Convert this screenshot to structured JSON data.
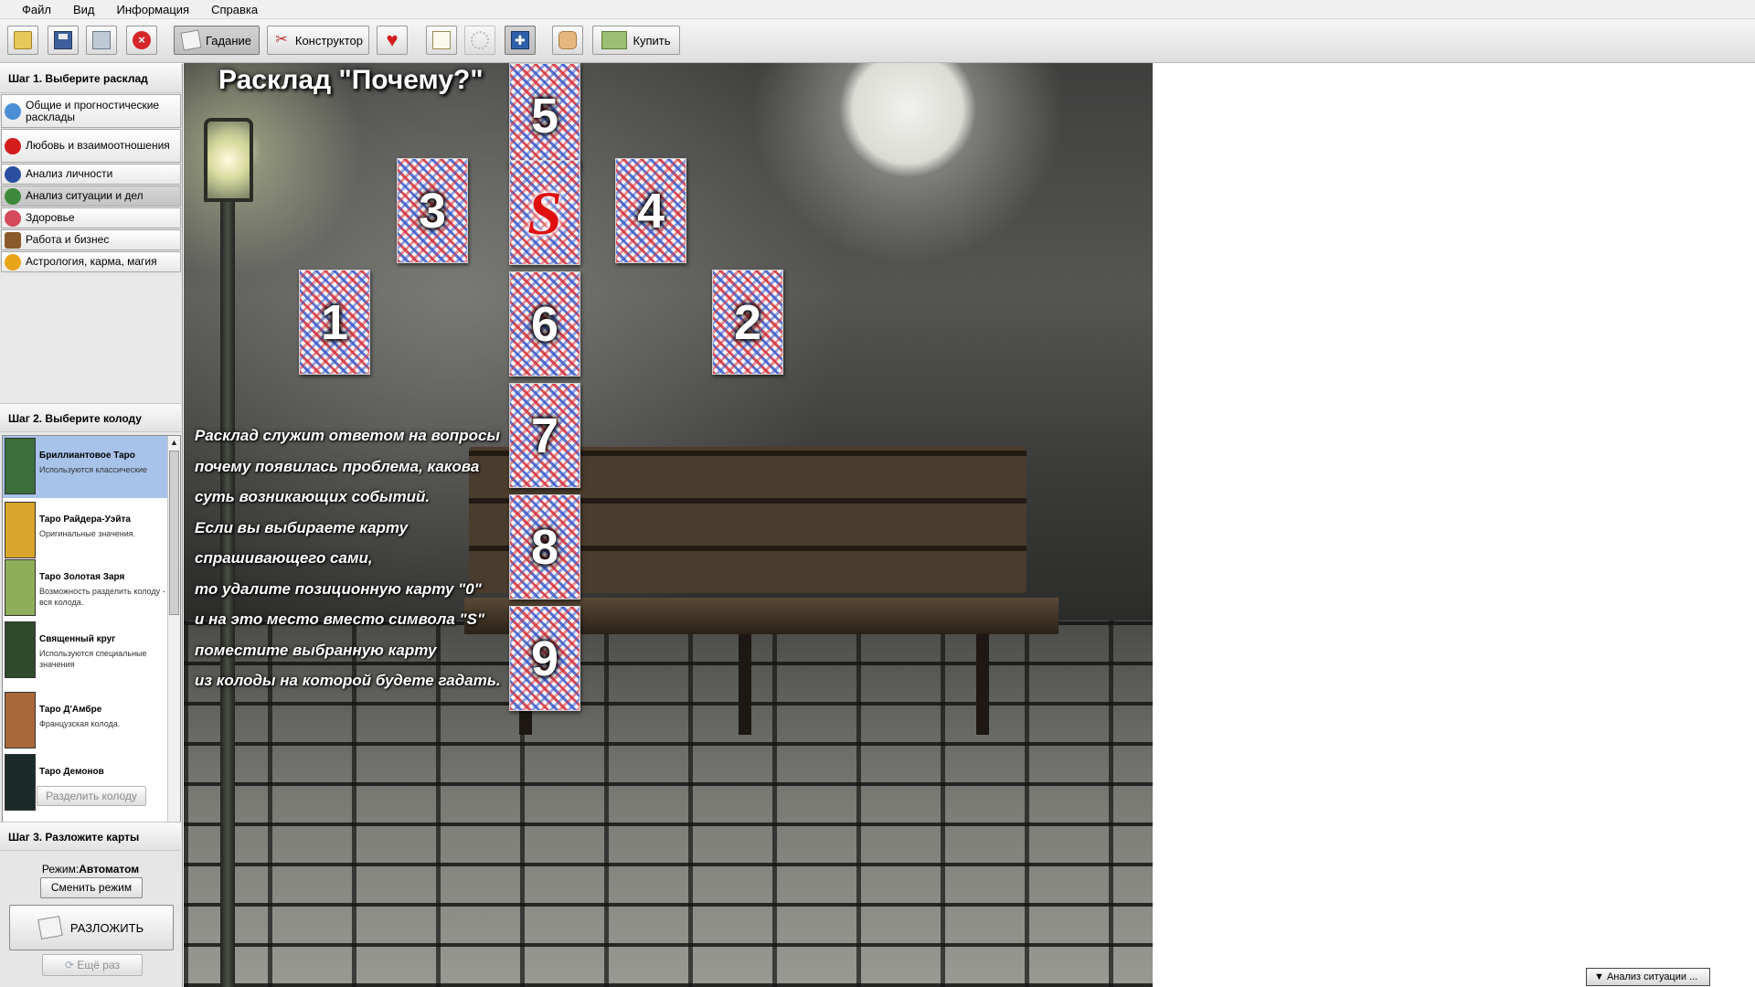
{
  "menu": {
    "items": [
      "Файл",
      "Вид",
      "Информация",
      "Справка"
    ]
  },
  "toolbar": {
    "open_icon": "folder-open-icon",
    "save_icon": "floppy-disk-icon",
    "print_icon": "print-icon",
    "close_icon": "close-red-icon",
    "gadanie_label": "Гадание",
    "konstruktor_label": "Конструктор",
    "favorites_icon": "heart-icon",
    "book_icon": "book-icon",
    "settings_icon": "gear-icon",
    "fullscreen_icon": "fullscreen-icon",
    "hand_icon": "hand-icon",
    "buy_label": "Купить",
    "active_tab": "Гадание"
  },
  "step1": {
    "title": "Шаг 1. Выберите расклад",
    "categories": [
      {
        "label": "Общие и прогностические расклады",
        "icon": "globe-icon",
        "color": "#4a8fd6"
      },
      {
        "label": "Любовь и взаимоотношения",
        "icon": "heart-icon",
        "color": "#d31d1d"
      },
      {
        "label": "Анализ личности",
        "icon": "person-icon",
        "color": "#2a4fa0"
      },
      {
        "label": "Анализ ситуации и дел",
        "icon": "globe-green-icon",
        "color": "#3f8a3a",
        "selected": true
      },
      {
        "label": "Здоровье",
        "icon": "health-icon",
        "color": "#d44a5a"
      },
      {
        "label": "Работа и бизнес",
        "icon": "briefcase-icon",
        "color": "#8a5a2a"
      },
      {
        "label": "Астрология, карма, магия",
        "icon": "star-icon",
        "color": "#e8a51a"
      }
    ]
  },
  "step2": {
    "title": "Шаг 2. Выберите колоду",
    "decks": [
      {
        "name": "Бриллиантовое Таро",
        "desc": "Используются классические",
        "selected": true,
        "thumb_color": "#3b6e3a"
      },
      {
        "name": "Таро Райдера-Уэйта",
        "desc": "Оригинальные значения.",
        "thumb_color": "#d9a52a"
      },
      {
        "name": "Таро Золотая Заря",
        "desc": "Возможность разделить колоду - вся колода.",
        "thumb_color": "#8fae5a"
      },
      {
        "name": "Священный круг",
        "desc": "Используются специальные значения",
        "thumb_color": "#2f4a2a"
      },
      {
        "name": "Таро Д'Амбре",
        "desc": "Французская колода.",
        "thumb_color": "#a8683a"
      },
      {
        "name": "Таро Демонов",
        "desc": "",
        "thumb_color": "#1c2a2a"
      }
    ],
    "split_label": "Разделить колоду"
  },
  "step3": {
    "title": "Шаг 3. Разложите карты",
    "mode_label": "Режим:",
    "mode_value": "Автоматом",
    "change_mode_label": "Сменить режим",
    "deal_label": "РАЗЛОЖИТЬ",
    "again_label": "Ещё раз"
  },
  "spread": {
    "title": "Расклад \"Почему?\"",
    "cards": [
      "5",
      "3",
      "S",
      "4",
      "1",
      "6",
      "2",
      "7",
      "8",
      "9"
    ],
    "description_lines": [
      "Расклад служит ответом на вопросы",
      "почему появилась проблема, какова",
      "суть возникающих событий.",
      "Если вы выбираете карту",
      "спрашивающего сами,",
      "то удалите позиционную карту \"0\"",
      "и на это место вместо символа \"S\"",
      "поместите выбранную карту",
      "из колоды на которой будете гадать."
    ]
  },
  "status": {
    "category_button": "▼ Анализ ситуации ..."
  }
}
